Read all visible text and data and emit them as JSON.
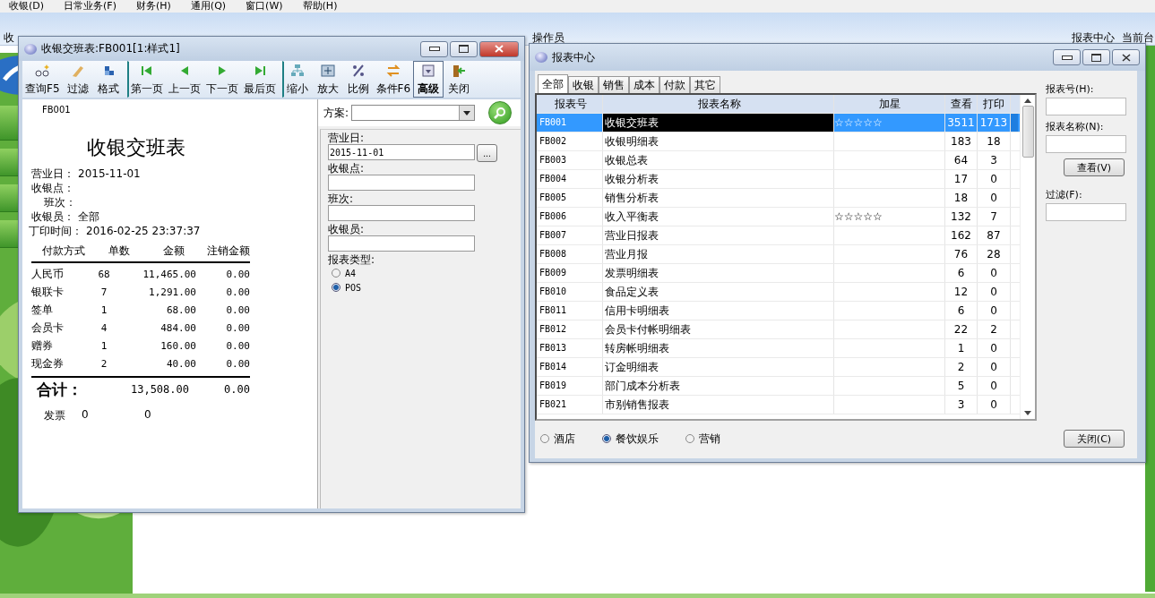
{
  "menu": [
    "收银(D)",
    "日常业务(F)",
    "财务(H)",
    "通用(Q)",
    "窗口(W)",
    "帮助(H)"
  ],
  "toolbar": [
    "收",
    "操作员",
    "报表中心",
    "当前台"
  ],
  "shift_window": {
    "title": "收银交班表:FB001[1:样式1]",
    "toolbar": [
      {
        "label": "查询F5",
        "selected": false
      },
      {
        "label": "过滤",
        "selected": false
      },
      {
        "label": "格式",
        "selected": false
      },
      {
        "label": "第一页",
        "selected": false
      },
      {
        "label": "上一页",
        "selected": false
      },
      {
        "label": "下一页",
        "selected": false
      },
      {
        "label": "最后页",
        "selected": false
      },
      {
        "label": "缩小",
        "selected": false
      },
      {
        "label": "放大",
        "selected": false
      },
      {
        "label": "比例",
        "selected": false
      },
      {
        "label": "条件F6",
        "selected": false
      },
      {
        "label": "高级",
        "selected": true
      },
      {
        "label": "关闭",
        "selected": false
      }
    ],
    "report": {
      "code": "FB001",
      "title": "收银交班表",
      "info": [
        {
          "label": "营业日：",
          "value": "2015-11-01"
        },
        {
          "label": "收银点："
        },
        {
          "label": "班次："
        },
        {
          "label": "收银员：",
          "value": "全部"
        },
        {
          "label": "丁印时间：",
          "value": "2016-02-25 23:37:37"
        }
      ],
      "columns": [
        "付款方式",
        "单数",
        "金额",
        "注销金额"
      ],
      "rows": [
        [
          "人民币",
          "68",
          "11,465.00",
          "0.00"
        ],
        [
          "银联卡",
          "7",
          "1,291.00",
          "0.00"
        ],
        [
          "签单",
          "1",
          "68.00",
          "0.00"
        ],
        [
          "会员卡",
          "4",
          "484.00",
          "0.00"
        ],
        [
          "赠券",
          "1",
          "160.00",
          "0.00"
        ],
        [
          "现金券",
          "2",
          "40.00",
          "0.00"
        ]
      ],
      "total": {
        "label": "合计：",
        "amount": "13,508.00",
        "void": "0.00"
      },
      "invoice": {
        "label": "发票",
        "count": "0",
        "amount": "0"
      }
    },
    "filter": {
      "scheme_label": "方案:",
      "fields": [
        {
          "label": "营业日:",
          "value": "2015-11-01",
          "picker": "..."
        },
        {
          "label": "收银点:"
        },
        {
          "label": "班次:"
        },
        {
          "label": "收银员:"
        }
      ],
      "type_label": "报表类型:",
      "types": [
        {
          "label": "A4",
          "selected": false
        },
        {
          "label": "POS",
          "selected": true
        }
      ]
    }
  },
  "report_window": {
    "title": "报表中心",
    "tabs": [
      {
        "label": "全部",
        "selected": true
      },
      {
        "label": "收银",
        "selected": false
      },
      {
        "label": "销售",
        "selected": false
      },
      {
        "label": "成本",
        "selected": false
      },
      {
        "label": "付款",
        "selected": false
      },
      {
        "label": "其它",
        "selected": false
      }
    ],
    "columns": [
      "报表号",
      "报表名称",
      "加星",
      "查看",
      "打印"
    ],
    "rows": [
      {
        "code": "FB001",
        "name": "收银交班表",
        "star": "☆☆☆☆☆",
        "view": "3511",
        "print": "1713",
        "selected": true
      },
      {
        "code": "FB002",
        "name": "收银明细表",
        "view": "183",
        "print": "18",
        "selected": false
      },
      {
        "code": "FB003",
        "name": "收银总表",
        "view": "64",
        "print": "3",
        "selected": false
      },
      {
        "code": "FB004",
        "name": "收银分析表",
        "view": "17",
        "print": "0",
        "selected": false
      },
      {
        "code": "FB005",
        "name": "销售分析表",
        "view": "18",
        "print": "0",
        "selected": false
      },
      {
        "code": "FB006",
        "name": "收入平衡表",
        "star": "☆☆☆☆☆",
        "view": "132",
        "print": "7",
        "selected": false
      },
      {
        "code": "FB007",
        "name": "营业日报表",
        "view": "162",
        "print": "87",
        "selected": false
      },
      {
        "code": "FB008",
        "name": "营业月报",
        "view": "76",
        "print": "28",
        "selected": false
      },
      {
        "code": "FB009",
        "name": "发票明细表",
        "view": "6",
        "print": "0",
        "selected": false
      },
      {
        "code": "FB010",
        "name": "食品定义表",
        "view": "12",
        "print": "0",
        "selected": false
      },
      {
        "code": "FB011",
        "name": "信用卡明细表",
        "view": "6",
        "print": "0",
        "selected": false
      },
      {
        "code": "FB012",
        "name": "会员卡付帐明细表",
        "view": "22",
        "print": "2",
        "selected": false
      },
      {
        "code": "FB013",
        "name": "转房帐明细表",
        "view": "1",
        "print": "0",
        "selected": false
      },
      {
        "code": "FB014",
        "name": "订金明细表",
        "view": "2",
        "print": "0",
        "selected": false
      },
      {
        "code": "FB019",
        "name": "部门成本分析表",
        "view": "5",
        "print": "0",
        "selected": false
      },
      {
        "code": "FB021",
        "name": "市别销售报表",
        "view": "3",
        "print": "0",
        "selected": false
      }
    ],
    "search": [
      {
        "label": "报表号(H):"
      },
      {
        "label": "报表名称(N):"
      }
    ],
    "view_button": "查看(V)",
    "filter_label": "过滤(F):",
    "close_button": "关闭(C)",
    "categories": [
      {
        "label": "酒店",
        "selected": false
      },
      {
        "label": "餐饮娱乐",
        "selected": true
      },
      {
        "label": "营销",
        "selected": false
      }
    ]
  }
}
